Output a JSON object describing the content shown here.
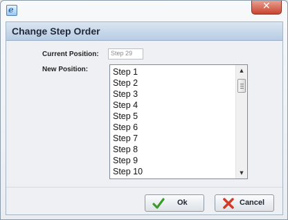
{
  "window": {
    "close_glyph": "✕",
    "app_icon_glyph": "e"
  },
  "dialog": {
    "title": "Change Step Order",
    "current_position_label": "Current Position:",
    "current_position_value": "Step 29",
    "new_position_label": "New Position:",
    "list_items": [
      "Step 1",
      "Step 2",
      "Step 3",
      "Step 4",
      "Step 5",
      "Step 6",
      "Step 7",
      "Step 8",
      "Step 9",
      "Step 10"
    ],
    "scroll_up_glyph": "▲",
    "scroll_down_glyph": "▼"
  },
  "buttons": {
    "ok_label": "Ok",
    "cancel_label": "Cancel"
  },
  "colors": {
    "ok_icon": "#3a9a2a",
    "cancel_icon": "#d23a2a",
    "header_gradient_top": "#dbe6f2",
    "header_gradient_bottom": "#b7cce3"
  }
}
